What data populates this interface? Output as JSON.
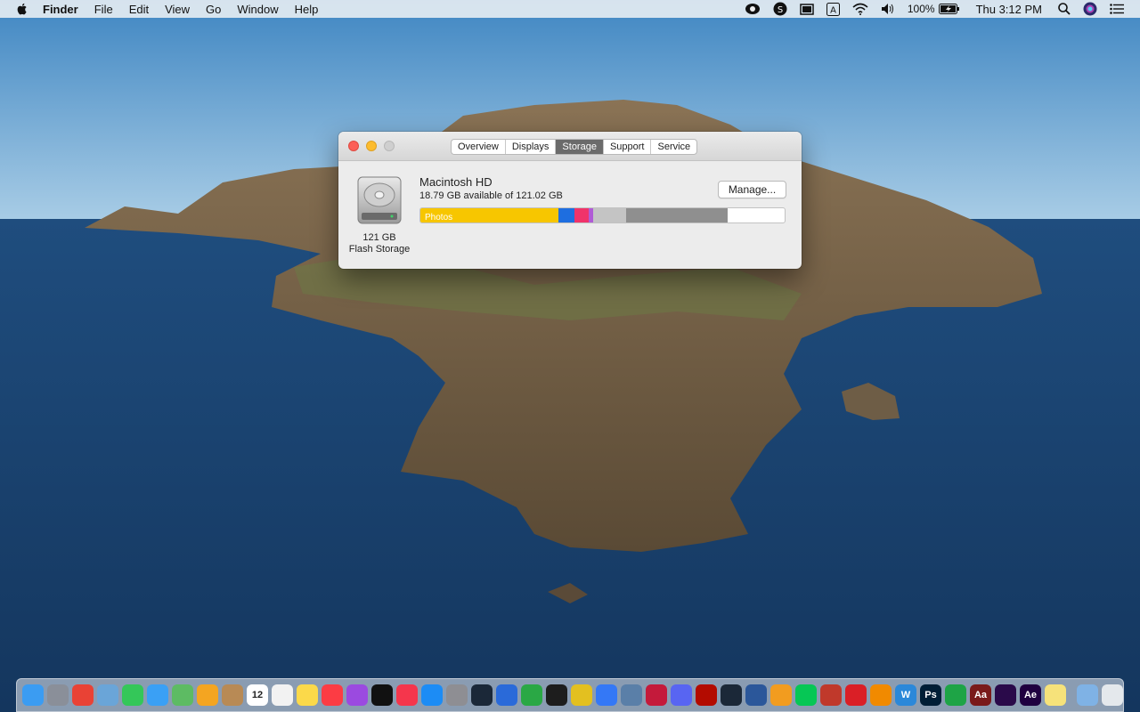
{
  "menubar": {
    "app_name": "Finder",
    "menus": [
      "File",
      "Edit",
      "View",
      "Go",
      "Window",
      "Help"
    ],
    "battery_percent": "100%",
    "clock": "Thu 3:12 PM"
  },
  "window": {
    "tabs": [
      "Overview",
      "Displays",
      "Storage",
      "Support",
      "Service"
    ],
    "active_tab": "Storage",
    "disk": {
      "capacity": "121 GB",
      "type": "Flash Storage",
      "name": "Macintosh HD",
      "available": "18.79 GB available of 121.02 GB",
      "manage_label": "Manage..."
    },
    "storage_segments": [
      {
        "label": "Photos",
        "fraction": 0.38,
        "color": "#f7c600"
      },
      {
        "label": "",
        "fraction": 0.043,
        "color": "#1e6ee0"
      },
      {
        "label": "",
        "fraction": 0.04,
        "color": "#f0336a"
      },
      {
        "label": "",
        "fraction": 0.012,
        "color": "#b05bd6"
      },
      {
        "label": "",
        "fraction": 0.09,
        "color": "#c4c4c4"
      },
      {
        "label": "",
        "fraction": 0.278,
        "color": "#8f8f8f"
      }
    ]
  },
  "dock": {
    "apps": [
      {
        "name": "finder",
        "color": "#3b9cf2"
      },
      {
        "name": "launchpad",
        "color": "#8a8f99"
      },
      {
        "name": "chrome",
        "color": "#e94235"
      },
      {
        "name": "preview",
        "color": "#6aa5d8"
      },
      {
        "name": "facetime",
        "color": "#34c759"
      },
      {
        "name": "messages",
        "color": "#3aa0f5"
      },
      {
        "name": "maps",
        "color": "#5dbb63"
      },
      {
        "name": "photos",
        "color": "#f4a521"
      },
      {
        "name": "contacts",
        "color": "#b88a55"
      },
      {
        "name": "calendar",
        "color": "#ffffff",
        "text": "12"
      },
      {
        "name": "reminders",
        "color": "#f2f2f2"
      },
      {
        "name": "notes",
        "color": "#fbd94a"
      },
      {
        "name": "music",
        "color": "#fc3c44"
      },
      {
        "name": "podcasts",
        "color": "#9b4ae0"
      },
      {
        "name": "tv",
        "color": "#111111"
      },
      {
        "name": "news",
        "color": "#f5364c"
      },
      {
        "name": "app-store",
        "color": "#1c8cf5"
      },
      {
        "name": "system-preferences",
        "color": "#8e8e93"
      },
      {
        "name": "steam",
        "color": "#1b2838"
      },
      {
        "name": "screens",
        "color": "#2a6ad9"
      },
      {
        "name": "money",
        "color": "#2aa845"
      },
      {
        "name": "game",
        "color": "#1d1d1d"
      },
      {
        "name": "scrabble",
        "color": "#e3c020"
      },
      {
        "name": "keynote",
        "color": "#3478f6"
      },
      {
        "name": "image-capture",
        "color": "#5a7fa8"
      },
      {
        "name": "mendeley",
        "color": "#c41a3b"
      },
      {
        "name": "discord",
        "color": "#5865f2"
      },
      {
        "name": "acrobat",
        "color": "#b30b00"
      },
      {
        "name": "steam-2",
        "color": "#1b2838"
      },
      {
        "name": "word",
        "color": "#2b579a"
      },
      {
        "name": "pages",
        "color": "#f29c1f"
      },
      {
        "name": "line",
        "color": "#06c755"
      },
      {
        "name": "utility",
        "color": "#c0392b"
      },
      {
        "name": "creative-cloud",
        "color": "#da1f26"
      },
      {
        "name": "vlc",
        "color": "#f18a00"
      },
      {
        "name": "wunderlist",
        "color": "#2b88d9",
        "text": "W"
      },
      {
        "name": "photoshop",
        "color": "#001e36",
        "text": "Ps"
      },
      {
        "name": "numbers",
        "color": "#1ea446"
      },
      {
        "name": "dictionary",
        "color": "#7a1a1a",
        "text": "Aa"
      },
      {
        "name": "premiere",
        "color": "#2a0a4a"
      },
      {
        "name": "after-effects",
        "color": "#1f0040",
        "text": "Ae"
      },
      {
        "name": "stickies",
        "color": "#f6e27a"
      }
    ],
    "right_apps": [
      {
        "name": "downloads-folder",
        "color": "#7fb2e5"
      },
      {
        "name": "trash",
        "color": "#e4e8ec"
      }
    ]
  }
}
